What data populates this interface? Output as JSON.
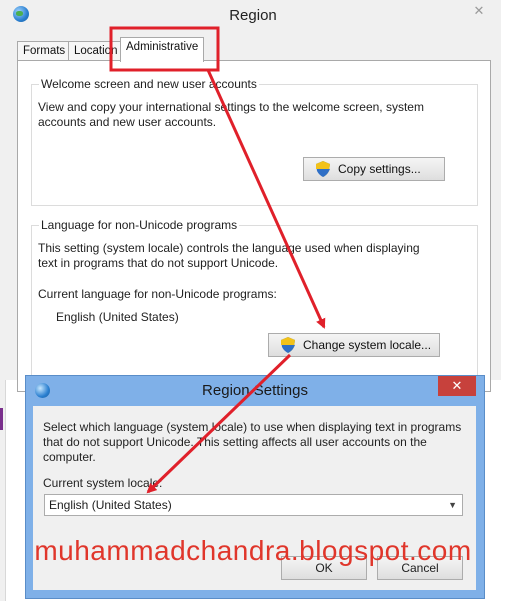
{
  "region_window": {
    "title": "Region",
    "close_glyph": "✕",
    "tabs": [
      {
        "label": "Formats"
      },
      {
        "label": "Location"
      },
      {
        "label": "Administrative"
      }
    ],
    "welcome": {
      "title": "Welcome screen and new user accounts",
      "text_line1": "View and copy your international settings to the welcome screen, system",
      "text_line2": "accounts and new user accounts.",
      "copy_button": "Copy settings..."
    },
    "non_unicode": {
      "title": "Language for non-Unicode programs",
      "text_line1": "This setting (system locale) controls the language used when displaying",
      "text_line2": "text in programs that do not support Unicode.",
      "current_label": "Current language for non-Unicode programs:",
      "current_value": "English (United States)",
      "change_button": "Change system locale..."
    }
  },
  "region_settings_dialog": {
    "title": "Region Settings",
    "close_glyph": "✕",
    "text_line1": "Select which language (system locale) to use when displaying text in programs",
    "text_line2": "that do not support Unicode. This setting affects all user accounts on the",
    "text_line3": "computer.",
    "current_label": "Current system locale:",
    "selected_locale": "English (United States)",
    "ok_button": "OK",
    "cancel_button": "Cancel"
  },
  "watermark": "muhammadchandra.blogspot.com",
  "icons": [
    "globe-icon",
    "uac-shield-icon",
    "close-icon",
    "dropdown-arrow-icon"
  ],
  "colors": {
    "annotation_red": "#e0202a",
    "dialog_frame": "#7fb0e8",
    "close_button": "#c7413c",
    "watermark": "#e0362b"
  }
}
